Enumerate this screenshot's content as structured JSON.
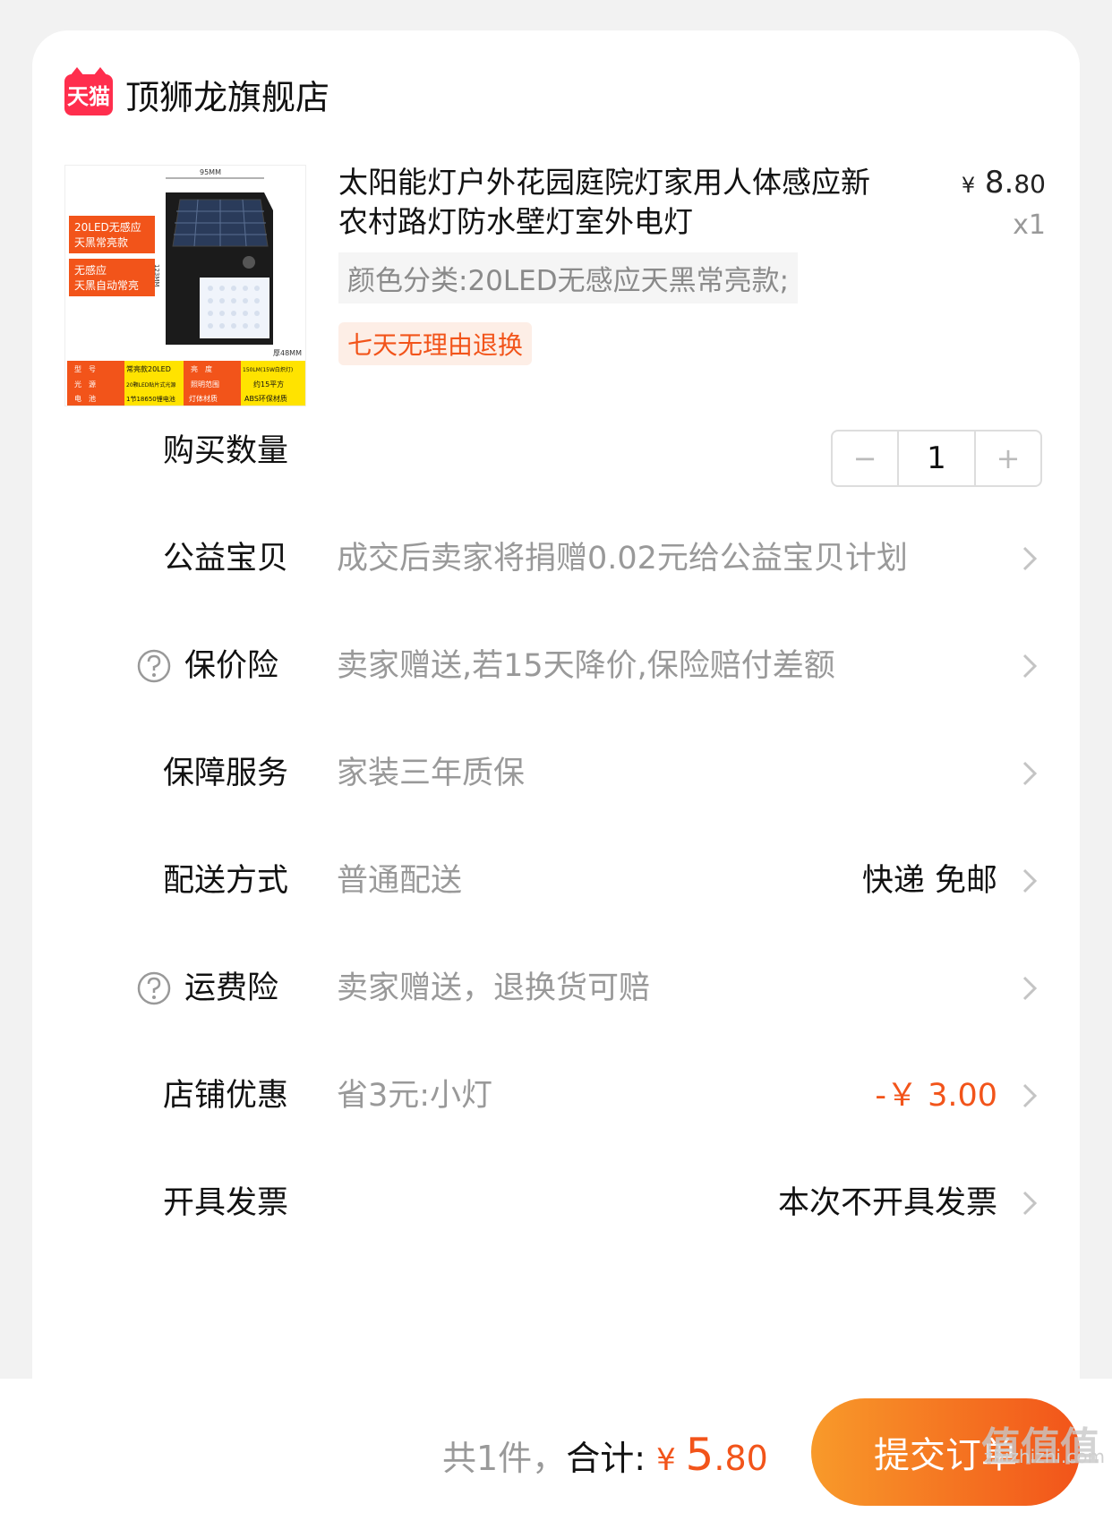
{
  "shop": {
    "logo_text": "天猫",
    "name": "顶狮龙旗舰店"
  },
  "product": {
    "title": "太阳能灯户外花园庭院灯家用人体感应新农村路灯防水壁灯室外电灯",
    "price_yen": "¥",
    "price_int": "8.",
    "price_dec": "80",
    "quantity_mark": "x1",
    "sku": "颜色分类:20LED无感应天黑常亮款;",
    "return_tag": "七天无理由退换",
    "image": {
      "label_1": "20LED无感应",
      "label_1b": "天黑常亮款",
      "label_2": "无感应",
      "label_2b": "天黑自动常亮",
      "dim_w": "95MM",
      "dim_h": "123MM",
      "dim_d": "厚48MM",
      "specs": [
        [
          "型　号",
          "常亮款20LED",
          "亮　度",
          "150LM(15W白炽灯)"
        ],
        [
          "光　源",
          "20颗LED贴片式光源",
          "照明范围",
          "约15平方"
        ],
        [
          "电　池",
          "1节18650锂电池",
          "灯体材质",
          "ABS环保材质"
        ]
      ]
    }
  },
  "rows": {
    "quantity": {
      "label": "购买数量",
      "minus": "−",
      "value": "1",
      "plus": "+"
    },
    "charity": {
      "label": "公益宝贝",
      "value": "成交后卖家将捐赠0.02元给公益宝贝计划"
    },
    "price_protect": {
      "label": "保价险",
      "value": "卖家赠送,若15天降价,保险赔付差额"
    },
    "service": {
      "label": "保障服务",
      "value": "家装三年质保"
    },
    "delivery": {
      "label": "配送方式",
      "value": "普通配送",
      "right": "快递 免邮"
    },
    "shipping_insurance": {
      "label": "运费险",
      "value": "卖家赠送，退换货可赔"
    },
    "shop_discount": {
      "label": "店铺优惠",
      "value": "省3元:小灯",
      "right": "-￥ 3.00"
    },
    "invoice": {
      "label": "开具发票",
      "right": "本次不开具发票"
    }
  },
  "bottom": {
    "count_text": "共1件，",
    "total_label": "合计:",
    "total_yen": "¥ ",
    "total_int": "5",
    "total_dec": ".80",
    "submit_label": "提交订单"
  },
  "watermark": {
    "mark": "值值值",
    "url": "zhizhizhi.com"
  },
  "colors": {
    "accent": "#f2541a",
    "tmall": "#ff2e4d",
    "muted": "#999999"
  }
}
